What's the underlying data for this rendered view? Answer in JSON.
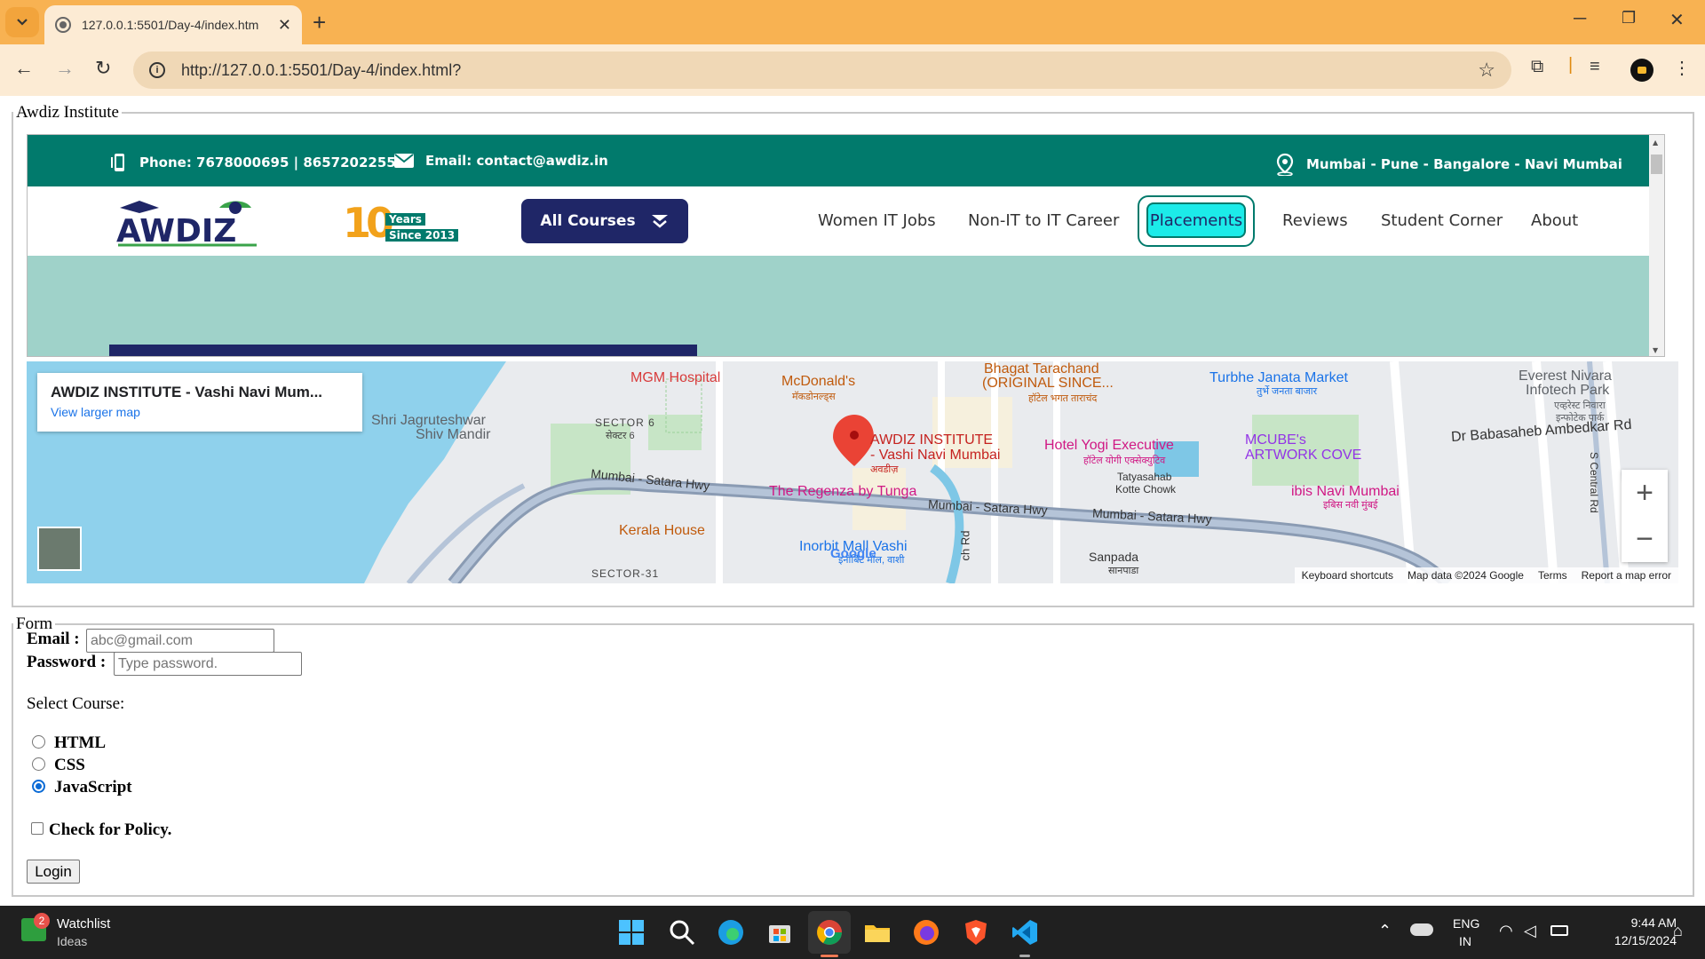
{
  "browser": {
    "tab_title": "127.0.0.1:5501/Day-4/index.htm",
    "url": "http://127.0.0.1:5501/Day-4/index.html?",
    "new_tab": "+",
    "close_tab": "✕"
  },
  "page": {
    "fieldset1_legend": "Awdiz Institute",
    "fieldset2_legend": "Form"
  },
  "site": {
    "phone": "Phone: 7678000695 |  8657202255",
    "email": "Email: contact@awdiz.in",
    "locations": "Mumbai - Pune - Bangalore - Navi Mumbai",
    "logo_text": "AWDIZ",
    "years_num": "10",
    "years_text": "Years",
    "since_text": "Since 2013",
    "all_courses": "All Courses",
    "menu": [
      "Women IT Jobs",
      "Non-IT to IT Career",
      "Placements",
      "Reviews",
      "Student Corner",
      "About"
    ]
  },
  "map": {
    "card_title": "AWDIZ INSTITUTE - Vashi Navi Mum...",
    "card_link": "View larger map",
    "zoom_in": "+",
    "zoom_out": "−",
    "footer": [
      "Keyboard shortcuts",
      "Map data ©2024 Google",
      "Terms",
      "Report a map error"
    ],
    "labels": {
      "mgm": "MGM Hospital",
      "mcd": "McDonald's",
      "mcd_hi": "मॅकडोनल्ड्स",
      "bhagat": "Bhagat Tarachand",
      "bhagat2": "(ORIGINAL SINCE...",
      "bhagat_hi": "हॉटेल भगत ताराचंद",
      "turbhe": "Turbhe Janata Market",
      "turbhe_hi": "तुर्भे जनता बाजार",
      "everest": "Everest Nivara",
      "everest2": "Infotech Park",
      "everest_hi": "एव्हरेस्ट निवारा",
      "everest_hi2": "इन्फोटेक पार्क",
      "shri": "Shri Jagruteshwar",
      "shri2": "Shiv Mandir",
      "sector6": "SECTOR 6",
      "sector6_hi": "सेक्टर 6",
      "awdiz": "AWDIZ INSTITUTE",
      "awdiz2": "- Vashi Navi Mumbai",
      "awdiz_hi": "अवडीज़",
      "hotel_yogi": "Hotel Yogi Executive",
      "hotel_yogi_hi": "हॉटेल योगी एक्सेक्युटिव",
      "mcube": "MCUBE's",
      "mcube2": "ARTWORK COVE",
      "ambedkar": "Dr Babasaheb Ambedkar Rd",
      "hwy1": "Mumbai - Satara Hwy",
      "hwy2": "Mumbai - Satara Hwy",
      "hwy3": "Mumbai - Satara Hwy",
      "regenza": "The Regenza by Tunga",
      "tatya": "Tatyasahab",
      "tatya2": "Kotte Chowk",
      "ibis": "ibis Navi Mumbai",
      "ibis_hi": "इबिस नवी मुंबई",
      "kerala": "Kerala House",
      "inorbit": "Inorbit Mall Vashi",
      "inorbit_hi": "इनॉर्बिट मॉल, वाशी",
      "sanpada": "Sanpada",
      "sanpada_hi": "सानपाडा",
      "sector31": "SECTOR-31",
      "ch_rd": "ch Rd",
      "central_rd": "S Central Rd",
      "google": "Google"
    }
  },
  "form": {
    "email_label": "Email :",
    "email_placeholder": "abc@gmail.com",
    "password_label": "Password :",
    "password_placeholder": "Type password.",
    "select_label": "Select Course:",
    "courses": [
      "HTML",
      "CSS",
      "JavaScript"
    ],
    "selected_course": "JavaScript",
    "policy_label": "Check for Policy.",
    "policy_checked": false,
    "login": "Login"
  },
  "taskbar": {
    "watchlist": "Watchlist",
    "ideas": "Ideas",
    "badge": "2",
    "lang1": "ENG",
    "lang2": "IN",
    "time": "9:44 AM",
    "date": "12/15/2024"
  },
  "colors": {
    "chrome_orange": "#f8b252",
    "site_teal": "#017a6c",
    "site_navy": "#1f2667",
    "placements_cyan": "#1cebe9",
    "hero_teal": "#9fd2c9"
  }
}
